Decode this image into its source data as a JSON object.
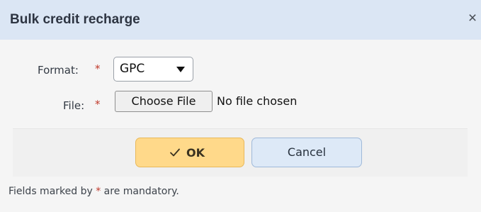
{
  "dialog": {
    "title": "Bulk credit recharge",
    "close_symbol": "×"
  },
  "form": {
    "format_label": "Format:",
    "format_required": "*",
    "format_value": "GPC",
    "file_label": "File:",
    "file_required": "*",
    "file_button": "Choose File",
    "file_status": "No file chosen"
  },
  "buttons": {
    "ok_label": "OK",
    "cancel_label": "Cancel"
  },
  "footer": {
    "note_before": "Fields marked by ",
    "note_star": "*",
    "note_after": " are mandatory."
  },
  "colors": {
    "titlebar": "#dbe6f4",
    "ok_button": "#ffd98a",
    "cancel_button": "#dde9f7",
    "required": "#c0392b"
  },
  "icons": {
    "close": "close-icon",
    "ok": "checkmark-icon",
    "select": "chevron-down-icon"
  }
}
